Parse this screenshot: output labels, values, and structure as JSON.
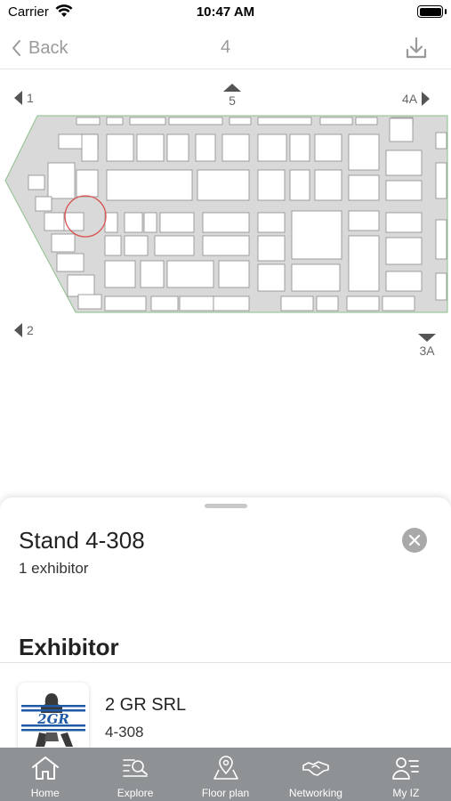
{
  "status_bar": {
    "carrier": "Carrier",
    "time": "10:47 AM",
    "battery_level": 1.0
  },
  "nav": {
    "back_label": "Back",
    "title": "4",
    "download_icon": "download-icon"
  },
  "map": {
    "hall_links": [
      {
        "id": "hall-1",
        "label": "1",
        "direction": "left"
      },
      {
        "id": "hall-5",
        "label": "5",
        "direction": "up"
      },
      {
        "id": "hall-4a",
        "label": "4A",
        "direction": "right"
      },
      {
        "id": "hall-2",
        "label": "2",
        "direction": "left"
      },
      {
        "id": "hall-3a",
        "label": "3A",
        "direction": "down"
      }
    ],
    "colors": {
      "floor": "#d9d9d9",
      "booth": "#ffffff",
      "outline": "#8cc08c",
      "highlight": "#d9534f"
    }
  },
  "sheet": {
    "stand_title": "Stand 4-308",
    "exhibitor_count": "1 exhibitor",
    "section_title": "Exhibitor",
    "exhibitors": [
      {
        "name": "2 GR SRL",
        "stand": "4-308",
        "logo_text": "2GR"
      }
    ]
  },
  "tab_bar": {
    "items": [
      {
        "id": "home",
        "label": "Home",
        "icon": "home-icon"
      },
      {
        "id": "explore",
        "label": "Explore",
        "icon": "explore-icon"
      },
      {
        "id": "floor-plan",
        "label": "Floor plan",
        "icon": "map-pin-icon"
      },
      {
        "id": "networking",
        "label": "Networking",
        "icon": "handshake-icon"
      },
      {
        "id": "my-iz",
        "label": "My IZ",
        "icon": "profile-list-icon"
      }
    ],
    "background": "#8e9294"
  }
}
